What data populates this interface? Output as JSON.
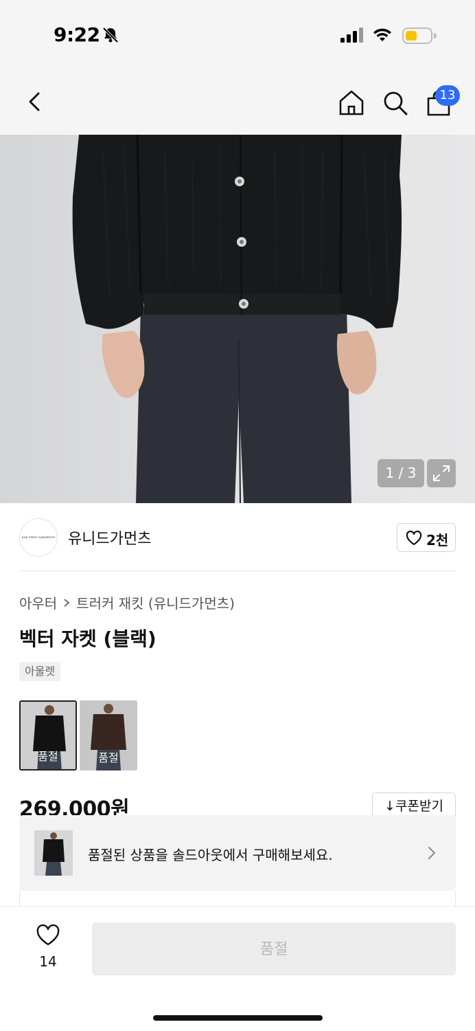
{
  "status_bar": {
    "time": "9:22"
  },
  "header": {
    "cart_count": "13"
  },
  "gallery": {
    "page_indicator": "1 / 3"
  },
  "brand": {
    "logo_text": "DAE NEED GARMENTS",
    "name": "유니드가먼츠",
    "like_count": "2천"
  },
  "product": {
    "breadcrumb": [
      "아우터",
      "트러커 재킷 (유니드가먼츠)"
    ],
    "title": "벡터 자켓 (블랙)",
    "tag": "아울렛",
    "colors": [
      {
        "label": "품절"
      },
      {
        "label": "품절"
      }
    ],
    "price": "269,000원",
    "coupon_label": "쿠폰받기"
  },
  "soldout_banner": {
    "text": "품절된 상품을 솔드아웃에서 구매해보세요."
  },
  "bottom_bar": {
    "wish_count": "14",
    "buy_label": "품절"
  }
}
